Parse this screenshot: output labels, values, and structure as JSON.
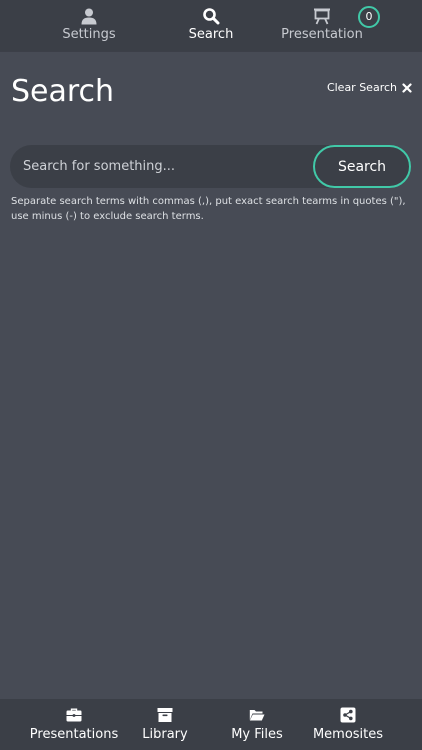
{
  "top_nav": {
    "items": [
      {
        "label": "Settings",
        "icon": "user-icon"
      },
      {
        "label": "Search",
        "icon": "search-icon"
      },
      {
        "label": "Presentation",
        "icon": "presentation-board-icon"
      }
    ],
    "active": "Search",
    "presentation_count": "0"
  },
  "page": {
    "title": "Search",
    "clear_label": "Clear Search"
  },
  "search": {
    "placeholder": "Search for something...",
    "value": "",
    "button_label": "Search",
    "help_text": "Separate search terms with commas (,), put exact search tearms in quotes (\"), use minus (-) to exclude search terms."
  },
  "bottom_nav": {
    "items": [
      {
        "label": "Presentations",
        "icon": "briefcase-icon"
      },
      {
        "label": "Library",
        "icon": "archive-box-icon"
      },
      {
        "label": "My Files",
        "icon": "folder-open-icon"
      },
      {
        "label": "Memosites",
        "icon": "share-icon"
      }
    ]
  },
  "colors": {
    "background": "#474b55",
    "bar": "#3b3f47",
    "accent": "#41c9a8",
    "text": "#ffffff"
  }
}
